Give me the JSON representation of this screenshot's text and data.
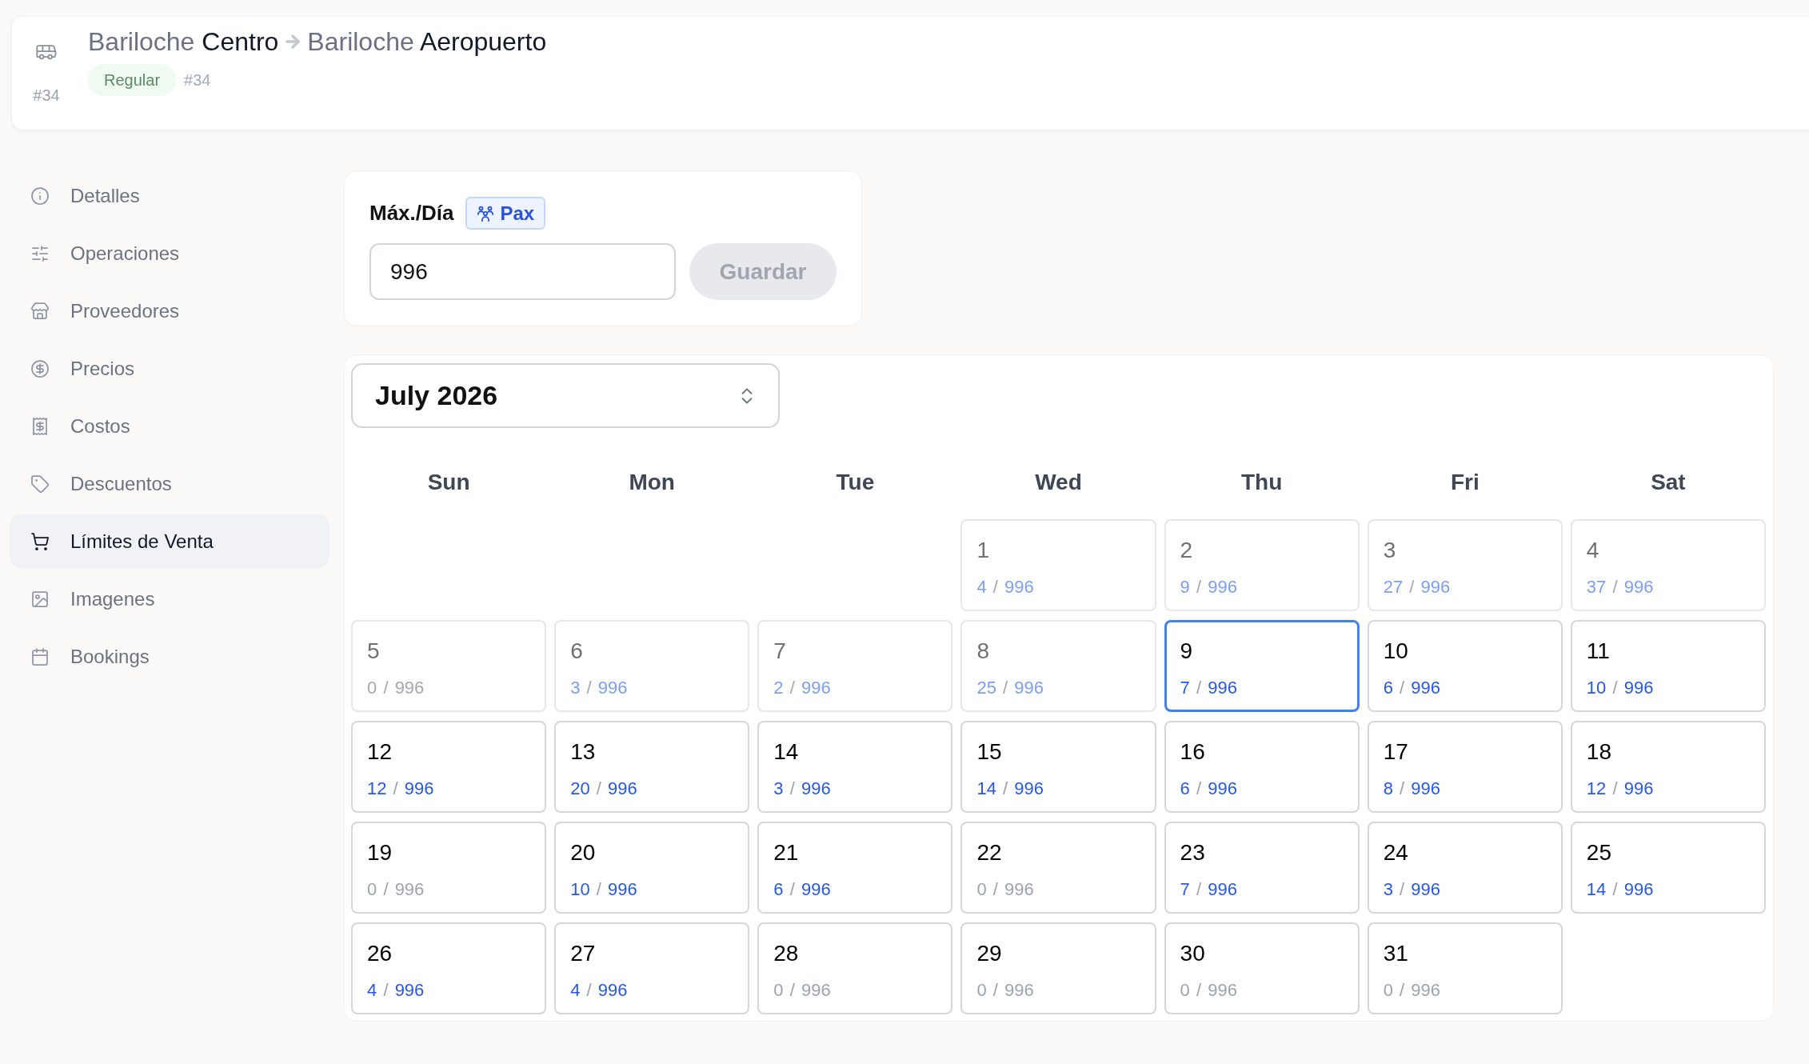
{
  "header": {
    "vehicle_id": "#34",
    "route": {
      "origin": {
        "city": "Bariloche",
        "place": "Centro"
      },
      "destination": {
        "city": "Bariloche",
        "place": "Aeropuerto"
      }
    },
    "badge": "Regular",
    "id": "#34"
  },
  "sidebar": {
    "items": [
      {
        "label": "Detalles",
        "selected": false
      },
      {
        "label": "Operaciones",
        "selected": false
      },
      {
        "label": "Proveedores",
        "selected": false
      },
      {
        "label": "Precios",
        "selected": false
      },
      {
        "label": "Costos",
        "selected": false
      },
      {
        "label": "Descuentos",
        "selected": false
      },
      {
        "label": "Límites de Venta",
        "selected": true
      },
      {
        "label": "Imagenes",
        "selected": false
      },
      {
        "label": "Bookings",
        "selected": false
      }
    ]
  },
  "daily_limit": {
    "label": "Máx./Día",
    "unit": "Pax",
    "input": {
      "value": "996"
    },
    "save_button": {
      "label": "Guardar",
      "disabled": true
    }
  },
  "calendar": {
    "month": "July 2026",
    "weekdays": [
      "Sun",
      "Mon",
      "Tue",
      "Wed",
      "Thu",
      "Fri",
      "Sat"
    ],
    "weeks": [
      [
        {
          "day": "1",
          "sold": "4",
          "separator": "/",
          "limit": "996",
          "disabled": true,
          "booked": true,
          "selected": false
        },
        {
          "day": "2",
          "sold": "9",
          "separator": "/",
          "limit": "996",
          "disabled": true,
          "booked": true,
          "selected": false
        },
        {
          "day": "3",
          "sold": "27",
          "separator": "/",
          "limit": "996",
          "disabled": true,
          "booked": true,
          "selected": false
        },
        {
          "day": "4",
          "sold": "37",
          "separator": "/",
          "limit": "996",
          "disabled": true,
          "booked": true,
          "selected": false
        }
      ],
      [
        {
          "day": "5",
          "sold": "0",
          "separator": "/",
          "limit": "996",
          "disabled": true,
          "booked": false,
          "selected": false
        },
        {
          "day": "6",
          "sold": "3",
          "separator": "/",
          "limit": "996",
          "disabled": true,
          "booked": true,
          "selected": false
        },
        {
          "day": "7",
          "sold": "2",
          "separator": "/",
          "limit": "996",
          "disabled": true,
          "booked": true,
          "selected": false
        },
        {
          "day": "8",
          "sold": "25",
          "separator": "/",
          "limit": "996",
          "disabled": true,
          "booked": true,
          "selected": false
        },
        {
          "day": "9",
          "sold": "7",
          "separator": "/",
          "limit": "996",
          "disabled": false,
          "booked": true,
          "selected": true
        },
        {
          "day": "10",
          "sold": "6",
          "separator": "/",
          "limit": "996",
          "disabled": false,
          "booked": true,
          "selected": false
        },
        {
          "day": "11",
          "sold": "10",
          "separator": "/",
          "limit": "996",
          "disabled": false,
          "booked": true,
          "selected": false
        }
      ],
      [
        {
          "day": "12",
          "sold": "12",
          "separator": "/",
          "limit": "996",
          "disabled": false,
          "booked": true,
          "selected": false
        },
        {
          "day": "13",
          "sold": "20",
          "separator": "/",
          "limit": "996",
          "disabled": false,
          "booked": true,
          "selected": false
        },
        {
          "day": "14",
          "sold": "3",
          "separator": "/",
          "limit": "996",
          "disabled": false,
          "booked": true,
          "selected": false
        },
        {
          "day": "15",
          "sold": "14",
          "separator": "/",
          "limit": "996",
          "disabled": false,
          "booked": true,
          "selected": false
        },
        {
          "day": "16",
          "sold": "6",
          "separator": "/",
          "limit": "996",
          "disabled": false,
          "booked": true,
          "selected": false
        },
        {
          "day": "17",
          "sold": "8",
          "separator": "/",
          "limit": "996",
          "disabled": false,
          "booked": true,
          "selected": false
        },
        {
          "day": "18",
          "sold": "12",
          "separator": "/",
          "limit": "996",
          "disabled": false,
          "booked": true,
          "selected": false
        }
      ],
      [
        {
          "day": "19",
          "sold": "0",
          "separator": "/",
          "limit": "996",
          "disabled": false,
          "booked": false,
          "selected": false
        },
        {
          "day": "20",
          "sold": "10",
          "separator": "/",
          "limit": "996",
          "disabled": false,
          "booked": true,
          "selected": false
        },
        {
          "day": "21",
          "sold": "6",
          "separator": "/",
          "limit": "996",
          "disabled": false,
          "booked": true,
          "selected": false
        },
        {
          "day": "22",
          "sold": "0",
          "separator": "/",
          "limit": "996",
          "disabled": false,
          "booked": false,
          "selected": false
        },
        {
          "day": "23",
          "sold": "7",
          "separator": "/",
          "limit": "996",
          "disabled": false,
          "booked": true,
          "selected": false
        },
        {
          "day": "24",
          "sold": "3",
          "separator": "/",
          "limit": "996",
          "disabled": false,
          "booked": true,
          "selected": false
        },
        {
          "day": "25",
          "sold": "14",
          "separator": "/",
          "limit": "996",
          "disabled": false,
          "booked": true,
          "selected": false
        }
      ],
      [
        {
          "day": "26",
          "sold": "4",
          "separator": "/",
          "limit": "996",
          "disabled": false,
          "booked": true,
          "selected": false
        },
        {
          "day": "27",
          "sold": "4",
          "separator": "/",
          "limit": "996",
          "disabled": false,
          "booked": true,
          "selected": false
        },
        {
          "day": "28",
          "sold": "0",
          "separator": "/",
          "limit": "996",
          "disabled": false,
          "booked": false,
          "selected": false
        },
        {
          "day": "29",
          "sold": "0",
          "separator": "/",
          "limit": "996",
          "disabled": false,
          "booked": false,
          "selected": false
        },
        {
          "day": "30",
          "sold": "0",
          "separator": "/",
          "limit": "996",
          "disabled": false,
          "booked": false,
          "selected": false
        },
        {
          "day": "31",
          "sold": "0",
          "separator": "/",
          "limit": "996",
          "disabled": false,
          "booked": false,
          "selected": false
        }
      ]
    ]
  }
}
